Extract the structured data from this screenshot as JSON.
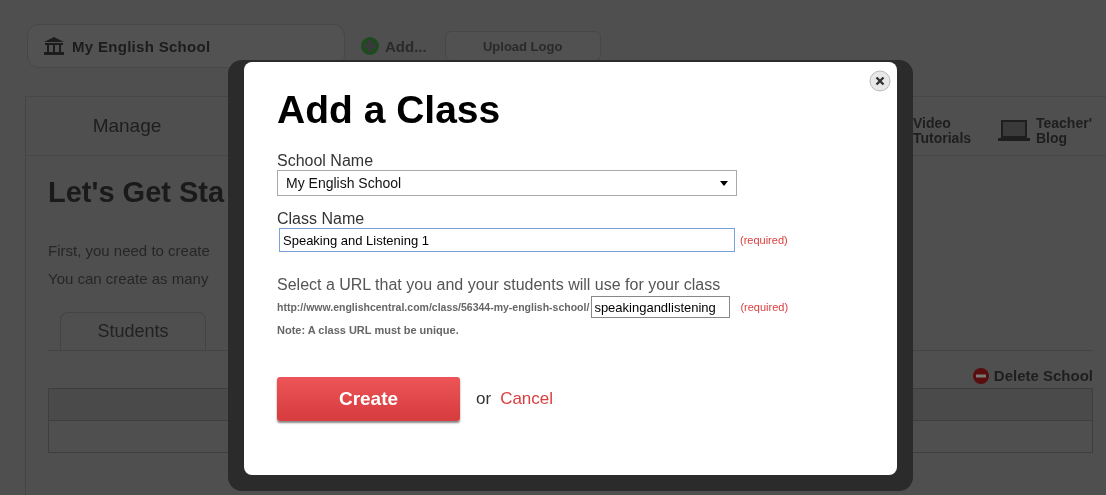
{
  "school_bar": {
    "name": "My English School",
    "add": "Add...",
    "upload": "Upload Logo"
  },
  "nav": {
    "tab": "Manage",
    "links": [
      {
        "kind": "video",
        "label": "Video\nTutorials"
      },
      {
        "kind": "blog",
        "label": "Teacher'\nBlog"
      }
    ]
  },
  "content": {
    "heading": "Let's Get Sta",
    "lines": [
      "First, you need to create",
      "You can create as many"
    ],
    "tab": "Students",
    "delete": "Delete School"
  },
  "modal": {
    "title": "Add a Class",
    "school_label": "School Name",
    "school_value": "My English School",
    "class_label": "Class Name",
    "class_value": "Speaking and Listening 1",
    "class_required": "(required)",
    "url_label": "Select a URL that you and your students will use for your class",
    "url_prefix": "http://www.englishcentral.com/class/56344-my-english-school/",
    "url_value": "speakingandlistening",
    "url_required": "(required)",
    "note": "Note: A class URL must be unique.",
    "create": "Create",
    "or": "or",
    "cancel": "Cancel"
  }
}
